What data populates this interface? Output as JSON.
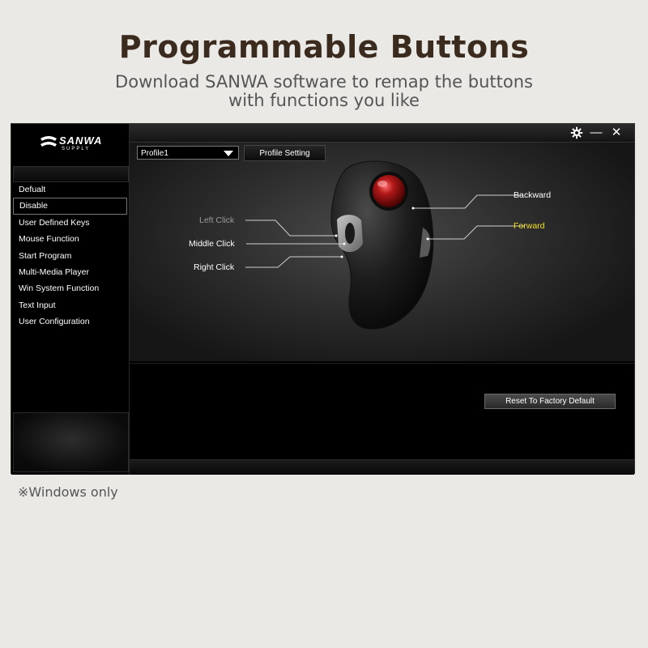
{
  "header": {
    "title": "Programmable Buttons",
    "subtitle_line1": "Download SANWA software to remap the buttons",
    "subtitle_line2": "with functions you like"
  },
  "app": {
    "logo": {
      "name": "SANWA",
      "sub": "SUPPLY"
    },
    "sidebar": {
      "items": [
        {
          "label": "Defualt"
        },
        {
          "label": "Disable",
          "active": true
        },
        {
          "label": "User Defined Keys"
        },
        {
          "label": "Mouse Function"
        },
        {
          "label": "Start Program"
        },
        {
          "label": "Multi-Media Player"
        },
        {
          "label": "Win System Function"
        },
        {
          "label": "Text Input"
        },
        {
          "label": "User Configuration"
        }
      ]
    },
    "window_controls": {
      "settings_icon": "gear-icon",
      "minimize": "—",
      "close": "✕"
    },
    "profile": {
      "selected": "Profile1",
      "setting_button": "Profile Setting"
    },
    "buttons": {
      "left_click": "Left Click",
      "middle_click": "Middle Click",
      "right_click": "Right Click",
      "backward": "Backward",
      "forward": "Forward"
    },
    "reset_button": "Reset To Factory Default",
    "colors": {
      "highlight": "#f5e02a",
      "dim_label": "#9a9a9a",
      "ball": "#b01818"
    }
  },
  "footnote": "※Windows only"
}
